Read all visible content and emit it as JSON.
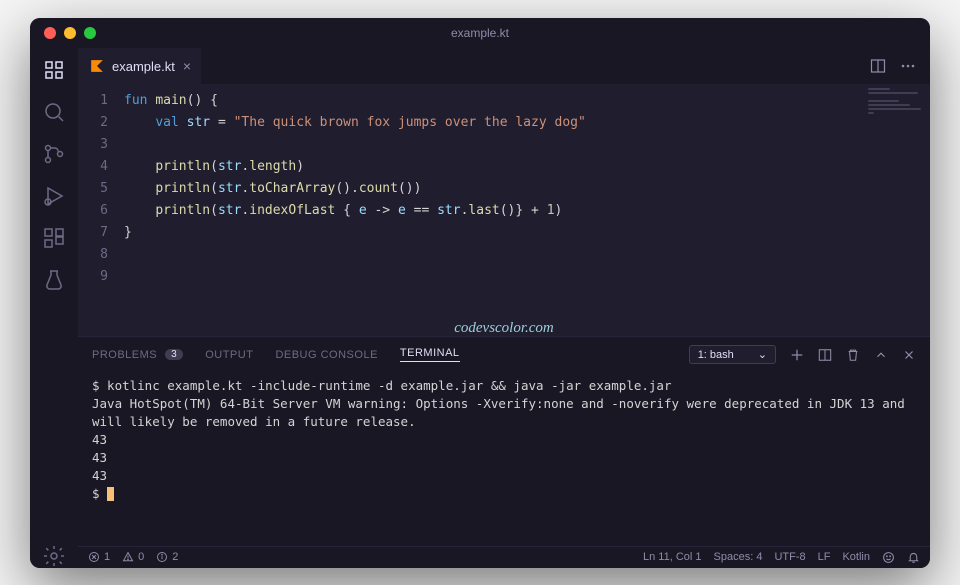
{
  "window": {
    "title": "example.kt"
  },
  "tab": {
    "filename": "example.kt"
  },
  "code": {
    "lines": [
      "1",
      "2",
      "3",
      "4",
      "5",
      "6",
      "7",
      "8",
      "9"
    ],
    "kw_fun": "fun",
    "fn_main": "main",
    "kw_val": "val",
    "var_str": "str",
    "str_literal": "\"The quick brown fox jumps over the lazy dog\"",
    "fn_println": "println",
    "prop_length": "length",
    "fn_toCharArray": "toCharArray",
    "fn_count": "count",
    "fn_indexOfLast": "indexOfLast",
    "param_e": "e",
    "fn_last": "last",
    "num_1": "1"
  },
  "watermark": "codevscolor.com",
  "panel": {
    "tabs": {
      "problems": "PROBLEMS",
      "problems_count": "3",
      "output": "OUTPUT",
      "debug": "DEBUG CONSOLE",
      "terminal": "TERMINAL"
    },
    "terminal_select": "1: bash"
  },
  "terminal": {
    "line1": "$ kotlinc example.kt -include-runtime -d example.jar && java -jar example.jar",
    "line2": "Java HotSpot(TM) 64-Bit Server VM warning: Options -Xverify:none and -noverify were deprecated in JDK 13 and will likely be removed in a future release.",
    "out1": "43",
    "out2": "43",
    "out3": "43",
    "prompt": "$ "
  },
  "status": {
    "errors": "1",
    "warnings": "0",
    "info": "2",
    "cursor": "Ln 11, Col 1",
    "spaces": "Spaces: 4",
    "encoding": "UTF-8",
    "eol": "LF",
    "lang": "Kotlin"
  }
}
